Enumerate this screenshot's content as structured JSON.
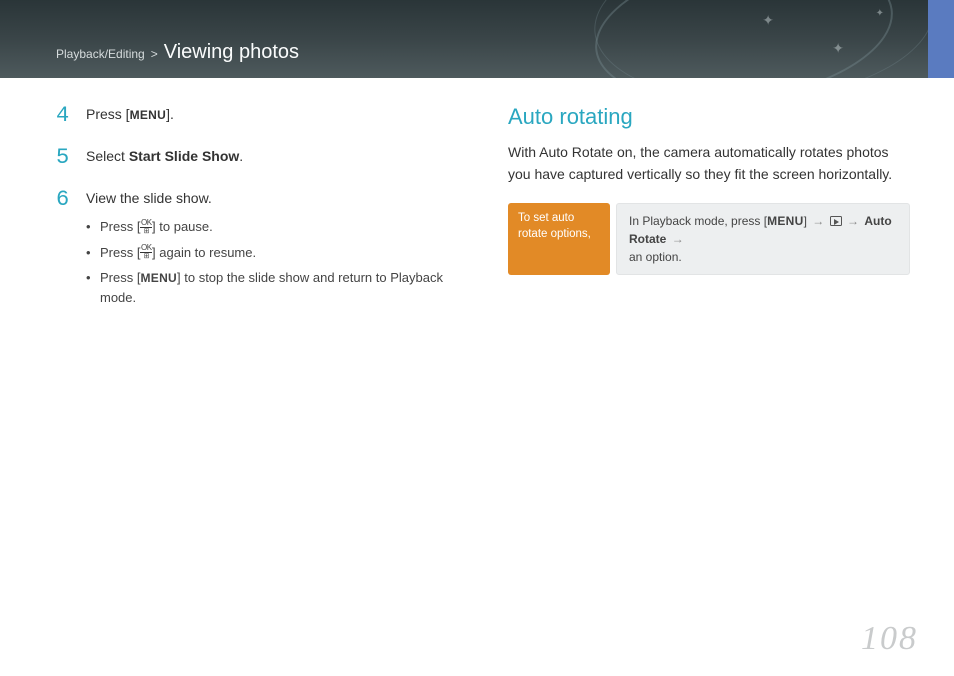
{
  "header": {
    "crumb_parent": "Playback/Editing",
    "crumb_sep": ">",
    "crumb_title": "Viewing photos"
  },
  "left": {
    "steps": [
      {
        "num": "4",
        "parts": [
          "Press [",
          "MENU",
          "]."
        ]
      },
      {
        "num": "5",
        "parts": [
          "Select ",
          "Start Slide Show",
          "."
        ]
      },
      {
        "num": "6",
        "parts": [
          "View the slide show."
        ],
        "subs": [
          {
            "pre": "Press [",
            "btn": "OK",
            "post": "] to pause."
          },
          {
            "pre": "Press [",
            "btn": "OK",
            "post": "] again to resume."
          },
          {
            "pre": "Press [",
            "btn": "MENU",
            "post": "] to stop the slide show and return to Playback mode."
          }
        ]
      }
    ]
  },
  "right": {
    "title": "Auto rotating",
    "desc": "With Auto Rotate on, the camera automatically rotates photos you have captured vertically so they fit the screen horizontally.",
    "option_label": "To set auto rotate options,",
    "option_body": {
      "pre": "In Playback mode, press [",
      "menu": "MENU",
      "mid": "] ",
      "arrow": "→",
      "auto_rotate": "Auto Rotate",
      "tail": "an option."
    }
  },
  "page_number": "108"
}
